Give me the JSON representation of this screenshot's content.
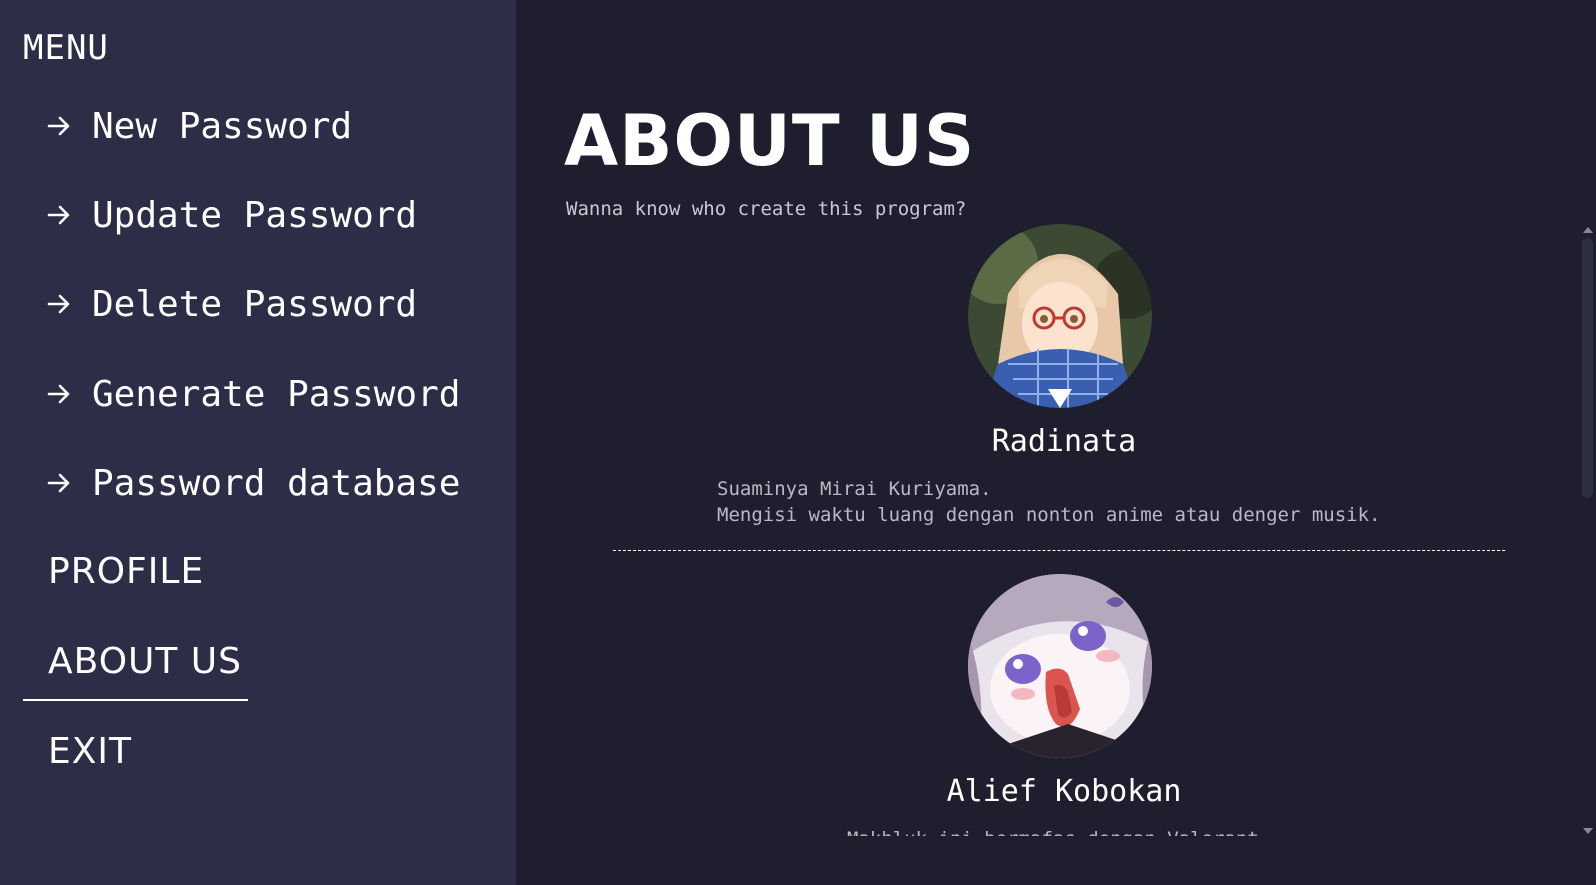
{
  "sidebar": {
    "menu_title": "MENU",
    "items": [
      {
        "label": "New Password"
      },
      {
        "label": "Update Password"
      },
      {
        "label": "Delete Password"
      },
      {
        "label": "Generate Password"
      },
      {
        "label": "Password database"
      }
    ],
    "profile_label": "PROFILE",
    "about_label": "ABOUT US",
    "exit_label": "EXIT",
    "active_section": "ABOUT US"
  },
  "main": {
    "title": "ABOUT US",
    "subtitle": "Wanna know who create this program?",
    "profiles": [
      {
        "name": "Radinata",
        "description_line1": "Suaminya Mirai Kuriyama.",
        "description_line2": "Mengisi waktu luang dengan nonton anime atau denger musik.",
        "avatar_icon": "anime-girl-glasses-avatar"
      },
      {
        "name": "Alief Kobokan",
        "description_line1": "Makhluk ini bermafas dengan Valorant",
        "avatar_icon": "chibi-anime-girl-avatar"
      }
    ]
  },
  "colors": {
    "sidebar_bg": "#2d2d48",
    "main_bg": "#1f1e2e",
    "text": "#ffffff",
    "muted_text": "#b9b9c4"
  }
}
